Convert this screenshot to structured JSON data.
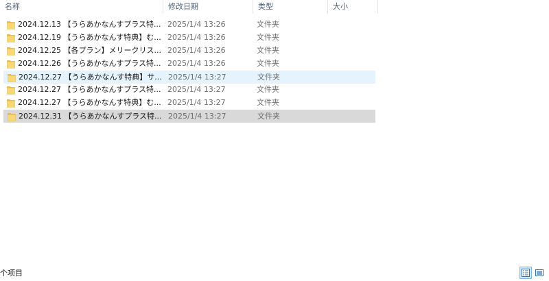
{
  "columns": {
    "name": "名称",
    "date_modified": "修改日期",
    "type": "类型",
    "size": "大小"
  },
  "files": [
    {
      "name": "2024.12.13 【うらあかなんすプラス特...",
      "date": "2025/1/4 13:26",
      "type": "文件夹",
      "state": "normal"
    },
    {
      "name": "2024.12.19 【うらあかなんす特典】む...",
      "date": "2025/1/4 13:26",
      "type": "文件夹",
      "state": "normal"
    },
    {
      "name": "2024.12.25 【各プラン】メリークリス...",
      "date": "2025/1/4 13:26",
      "type": "文件夹",
      "state": "normal"
    },
    {
      "name": "2024.12.26 【うらあかなんすプラス特...",
      "date": "2025/1/4 13:26",
      "type": "文件夹",
      "state": "normal"
    },
    {
      "name": "2024.12.27 【うらあかなんす特典】サ...",
      "date": "2025/1/4 13:27",
      "type": "文件夹",
      "state": "hover"
    },
    {
      "name": "2024.12.27 【うらあかなんすプラス特...",
      "date": "2025/1/4 13:27",
      "type": "文件夹",
      "state": "normal"
    },
    {
      "name": "2024.12.27 【うらあかなんす特典】む...",
      "date": "2025/1/4 13:27",
      "type": "文件夹",
      "state": "normal"
    },
    {
      "name": "2024.12.31 【うらあかなんすプラス特...",
      "date": "2025/1/4 13:27",
      "type": "文件夹",
      "state": "selected"
    }
  ],
  "status": {
    "item_count_text": "个项目"
  },
  "icons": {
    "folder": "folder-icon",
    "details_view": "details-view-icon",
    "large_icons_view": "large-icons-view-icon"
  },
  "colors": {
    "hover_row": "#e5f3ff",
    "selected_row": "#d9d9d9",
    "header_text": "#4c607a",
    "secondary_text": "#6d6d6d",
    "folder_yellow": "#f8d775"
  }
}
